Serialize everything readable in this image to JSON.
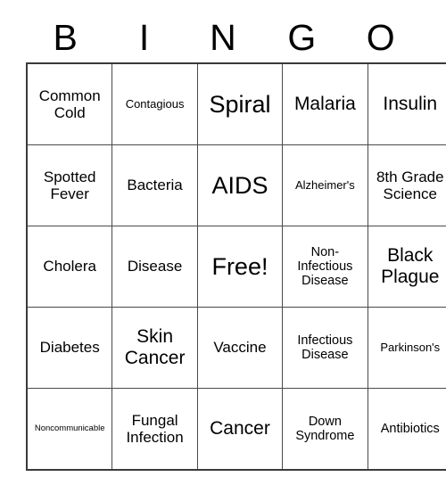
{
  "card": {
    "header": {
      "letters": [
        "B",
        "I",
        "N",
        "G",
        "O"
      ]
    },
    "rows": [
      [
        {
          "text": "Common Cold",
          "size": "fs-md"
        },
        {
          "text": "Contagious",
          "size": "fs-xs"
        },
        {
          "text": "Spiral",
          "size": "fs-xl"
        },
        {
          "text": "Malaria",
          "size": "fs-lg"
        },
        {
          "text": "Insulin",
          "size": "fs-lg"
        }
      ],
      [
        {
          "text": "Spotted Fever",
          "size": "fs-md"
        },
        {
          "text": "Bacteria",
          "size": "fs-md"
        },
        {
          "text": "AIDS",
          "size": "fs-xl"
        },
        {
          "text": "Alzheimer's",
          "size": "fs-xs"
        },
        {
          "text": "8th Grade Science",
          "size": "fs-md"
        }
      ],
      [
        {
          "text": "Cholera",
          "size": "fs-md"
        },
        {
          "text": "Disease",
          "size": "fs-md"
        },
        {
          "text": "Free!",
          "size": "fs-xl"
        },
        {
          "text": "Non-Infectious Disease",
          "size": "fs-sm"
        },
        {
          "text": "Black Plague",
          "size": "fs-lg"
        }
      ],
      [
        {
          "text": "Diabetes",
          "size": "fs-md"
        },
        {
          "text": "Skin Cancer",
          "size": "fs-lg"
        },
        {
          "text": "Vaccine",
          "size": "fs-md"
        },
        {
          "text": "Infectious Disease",
          "size": "fs-sm"
        },
        {
          "text": "Parkinson's",
          "size": "fs-xs"
        }
      ],
      [
        {
          "text": "Noncommunicable",
          "size": "fs-xxs"
        },
        {
          "text": "Fungal Infection",
          "size": "fs-md"
        },
        {
          "text": "Cancer",
          "size": "fs-lg"
        },
        {
          "text": "Down Syndrome",
          "size": "fs-sm"
        },
        {
          "text": "Antibiotics",
          "size": "fs-sm"
        }
      ]
    ],
    "free_space": {
      "row": 2,
      "column": 2,
      "label": "Free!"
    },
    "colors": {
      "background": "#ffffff",
      "text": "#000000",
      "border": "#4a4a4a",
      "outer_border": "#3a3a3a"
    }
  }
}
